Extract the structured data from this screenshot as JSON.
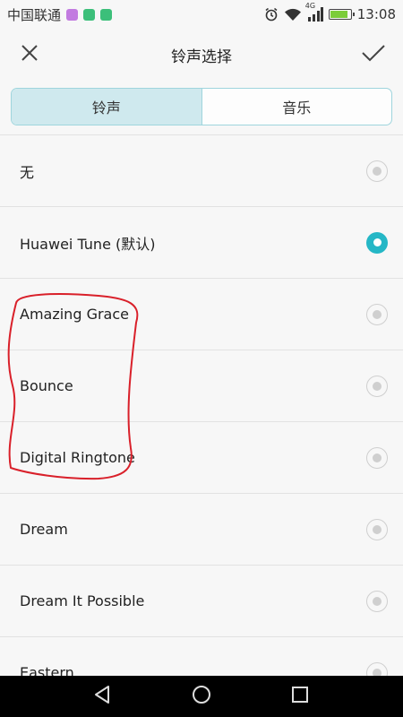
{
  "status_bar": {
    "carrier": "中国联通",
    "network": "4G",
    "time": "13:08",
    "notification_colors": [
      "#c27be0",
      "#3cbf7a",
      "#3cbf7a"
    ],
    "icons": [
      "alarm-icon",
      "wifi-icon",
      "signal-icon",
      "battery-charging-icon"
    ]
  },
  "header": {
    "title": "铃声选择",
    "close_icon": "close-icon",
    "confirm_icon": "check-icon"
  },
  "tabs": [
    {
      "label": "铃声",
      "active": true
    },
    {
      "label": "音乐",
      "active": false
    }
  ],
  "ringtones": [
    {
      "label": "无",
      "selected": false
    },
    {
      "label": "Huawei Tune (默认)",
      "selected": true
    },
    {
      "label": "Amazing Grace",
      "selected": false
    },
    {
      "label": "Bounce",
      "selected": false
    },
    {
      "label": "Digital Ringtone",
      "selected": false
    },
    {
      "label": "Dream",
      "selected": false
    },
    {
      "label": "Dream It Possible",
      "selected": false
    },
    {
      "label": "Eastern",
      "selected": false
    }
  ],
  "colors": {
    "accent": "#25b7c6",
    "tab_active_bg": "#cfe9ee",
    "annotation": "#d9202a"
  },
  "nav_bar": {
    "icons": [
      "back-icon",
      "home-icon",
      "recents-icon"
    ]
  }
}
